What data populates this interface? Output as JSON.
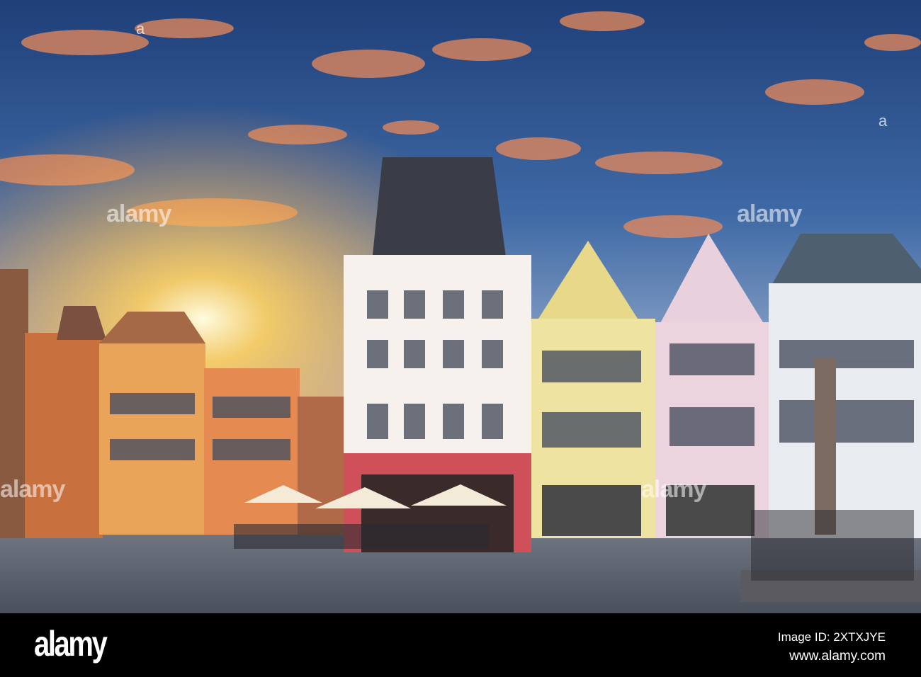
{
  "watermark": {
    "brand": "alamy",
    "corner_mark": "a"
  },
  "footer": {
    "logo": "alamy",
    "image_id": "Image ID: 2XTXJYE",
    "url": "www.alamy.com"
  },
  "colors": {
    "sky_top": "#2a4f8a",
    "sunset": "#ffb347",
    "footer_bg": "#000000"
  }
}
